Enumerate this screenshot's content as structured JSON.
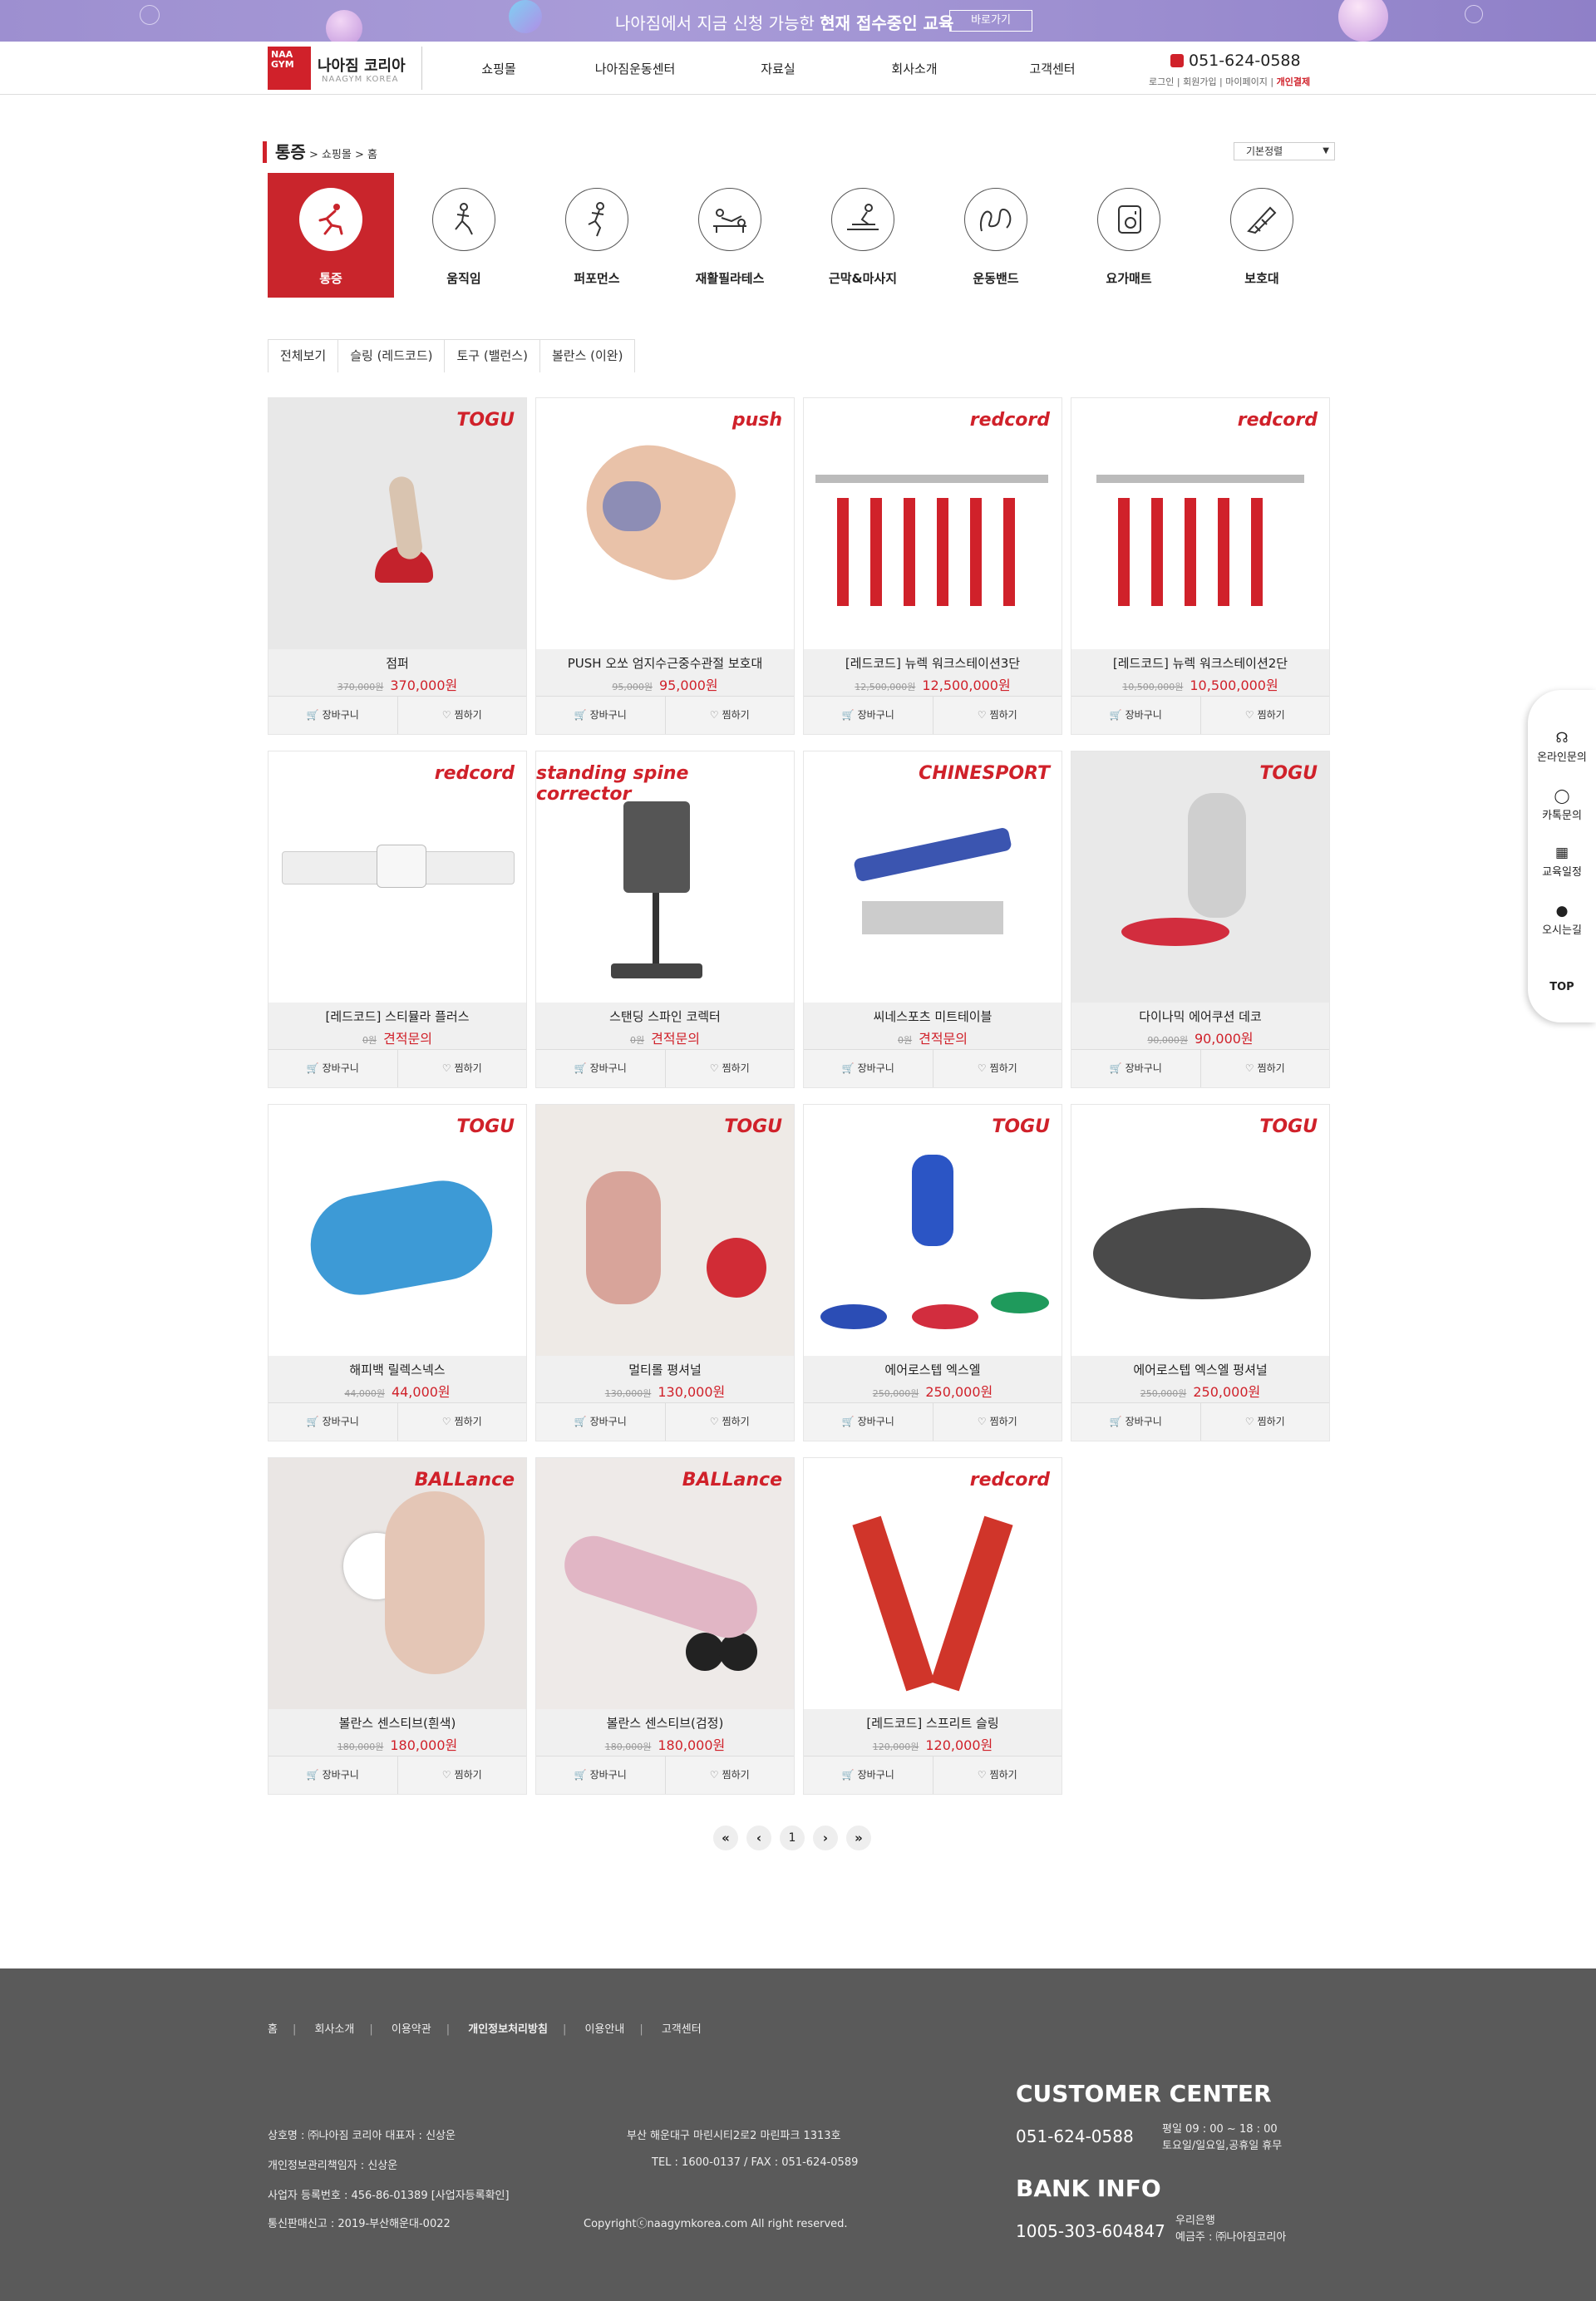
{
  "banner": {
    "text_prefix": "나아짐에서 지금 신청 가능한",
    "text_bold": "현재 접수중인 교육",
    "button": "바로가기"
  },
  "header": {
    "logo_box": "NAA GYM",
    "logo_name": "나아짐 코리아",
    "logo_sub": "NAAGYM KOREA",
    "nav": [
      "쇼핑몰",
      "나아짐운동센터",
      "자료실",
      "회사소개",
      "고객센터"
    ],
    "phone": "051-624-0588",
    "links": [
      "로그인",
      "회원가입",
      "마이페이지",
      "개인결제"
    ]
  },
  "breadcrumb": {
    "title": "통증",
    "path": " > 쇼핑몰 > 홈"
  },
  "sort": {
    "selected": "기본정렬"
  },
  "categories": [
    {
      "label": "통증",
      "icon": "pain-icon",
      "active": true
    },
    {
      "label": "움직임",
      "icon": "movement-icon"
    },
    {
      "label": "퍼포먼스",
      "icon": "performance-icon"
    },
    {
      "label": "재활필라테스",
      "icon": "pilates-icon"
    },
    {
      "label": "근막&마사지",
      "icon": "massage-icon"
    },
    {
      "label": "운동밴드",
      "icon": "band-icon"
    },
    {
      "label": "요가매트",
      "icon": "mat-icon"
    },
    {
      "label": "보호대",
      "icon": "brace-icon"
    }
  ],
  "tabs": [
    "전체보기",
    "슬링 (레드코드)",
    "토구 (밸런스)",
    "볼란스 (이완)"
  ],
  "buttons": {
    "cart": "장바구니",
    "wish": "찜하기"
  },
  "products": [
    {
      "name": "점퍼",
      "old": "370,000원",
      "price": "370,000원",
      "brand": "TOGU"
    },
    {
      "name": "PUSH 오쏘 엄지수근중수관절 보호대",
      "old": "95,000원",
      "price": "95,000원",
      "brand": "push"
    },
    {
      "name": "[레드코드] 뉴렉 워크스테이션3단",
      "old": "12,500,000원",
      "price": "12,500,000원",
      "brand": "redcord"
    },
    {
      "name": "[레드코드] 뉴렉 워크스테이션2단",
      "old": "10,500,000원",
      "price": "10,500,000원",
      "brand": "redcord"
    },
    {
      "name": "[레드코드] 스티뮬라 플러스",
      "old": "0원",
      "price": "견적문의",
      "brand": "redcord"
    },
    {
      "name": "스탠딩 스파인 코렉터",
      "old": "0원",
      "price": "견적문의",
      "brand": "standing spine corrector"
    },
    {
      "name": "씨네스포츠 미트테이블",
      "old": "0원",
      "price": "견적문의",
      "brand": "CHINESPORT"
    },
    {
      "name": "다이나믹 에어쿠션 데코",
      "old": "90,000원",
      "price": "90,000원",
      "brand": "TOGU"
    },
    {
      "name": "해피백 릴렉스넥스",
      "old": "44,000원",
      "price": "44,000원",
      "brand": "TOGU"
    },
    {
      "name": "멀티롤 평셔널",
      "old": "130,000원",
      "price": "130,000원",
      "brand": "TOGU"
    },
    {
      "name": "에어로스텝 엑스엘",
      "old": "250,000원",
      "price": "250,000원",
      "brand": "TOGU"
    },
    {
      "name": "에어로스텝 엑스엘 펑셔널",
      "old": "250,000원",
      "price": "250,000원",
      "brand": "TOGU"
    },
    {
      "name": "볼란스 센스티브(흰색)",
      "old": "180,000원",
      "price": "180,000원",
      "brand": "BALLance"
    },
    {
      "name": "볼란스 센스티브(검정)",
      "old": "180,000원",
      "price": "180,000원",
      "brand": "BALLance"
    },
    {
      "name": "[레드코드] 스프리트 슬링",
      "old": "120,000원",
      "price": "120,000원",
      "brand": "redcord"
    }
  ],
  "pagination": {
    "current": "1"
  },
  "quick_menu": [
    "온라인문의",
    "카톡문의",
    "교육일정",
    "오시는길",
    "TOP"
  ],
  "footer": {
    "links": [
      "홈",
      "회사소개",
      "이용약관",
      "개인정보처리방침",
      "이용안내",
      "고객센터"
    ],
    "info_left": [
      "상호명 : ㈜나아짐 코리아 대표자 : 신상운",
      "개인정보관리책임자 : 신상운",
      "사업자 등록번호 : 456-86-01389 [사업자등록확인]",
      "통신판매신고 : 2019-부산해운대-0022"
    ],
    "info_mid": [
      "부산 해운대구 마린시티2로2 마린파크 1313호",
      "TEL : 1600-0137 / FAX : 051-624-0589",
      "Copyrightⓒnaagymkorea.com All right reserved."
    ],
    "cc_title": "CUSTOMER CENTER",
    "cc_phone": "051-624-0588",
    "cc_hours": [
      "평일 09 : 00 ~ 18 : 00",
      "토요일/일요일,공휴일 휴무"
    ],
    "bank_title": "BANK INFO",
    "bank_account": "1005-303-604847",
    "bank_info": [
      "우리은행",
      "예금주 : ㈜나아짐코리아"
    ]
  },
  "colors": {
    "accent": "#d0212a",
    "footer_bg": "#5a5a5a",
    "banner_bg": "#9d8fd0"
  }
}
